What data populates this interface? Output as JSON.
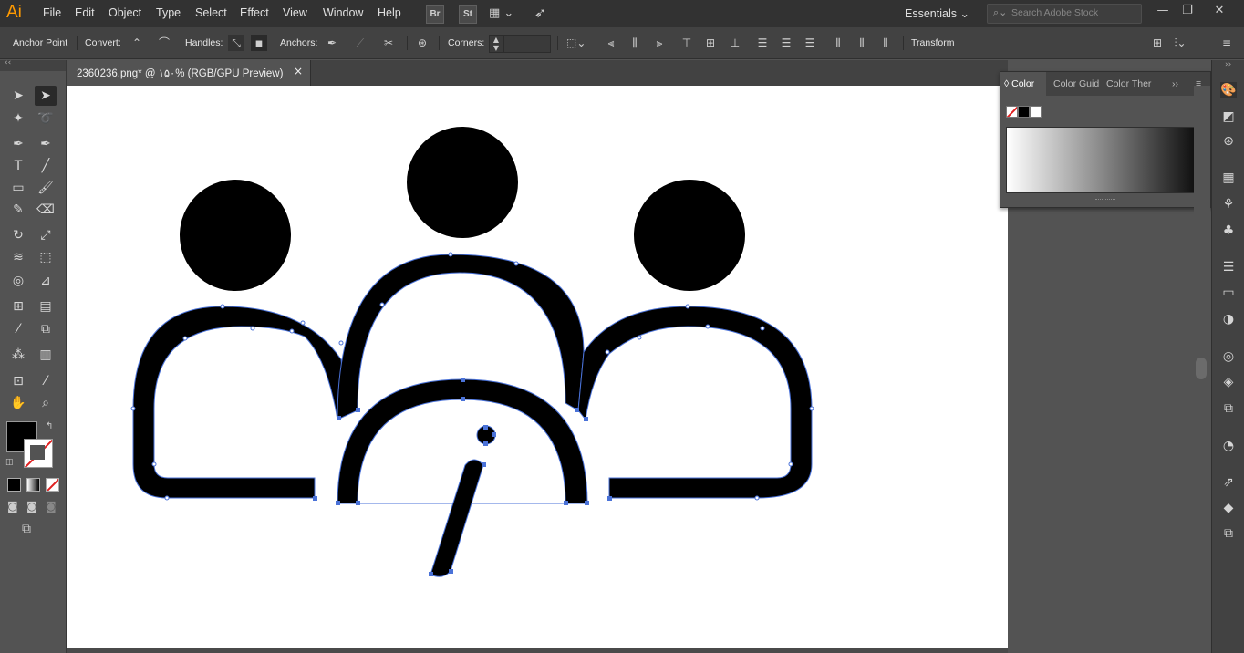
{
  "app": {
    "logo": "Ai"
  },
  "menu": [
    "File",
    "Edit",
    "Object",
    "Type",
    "Select",
    "Effect",
    "View",
    "Window",
    "Help"
  ],
  "menubar_icons": {
    "bridge": "Br",
    "stock": "St"
  },
  "workspace": {
    "label": "Essentials"
  },
  "search": {
    "placeholder": "Search Adobe Stock"
  },
  "control_bar": {
    "anchor_point": "Anchor Point",
    "convert": "Convert:",
    "handles": "Handles:",
    "anchors": "Anchors:",
    "corners": "Corners:",
    "transform": "Transform"
  },
  "document_tab": {
    "title": "2360236.png* @ ۱۵۰% (RGB/GPU Preview)",
    "close": "×"
  },
  "color_panel": {
    "tabs": [
      "Color",
      "Color Guid",
      "Color Ther"
    ],
    "spectrum_colors": [
      "#ffffff",
      "#111111"
    ]
  },
  "colors": {
    "fill": "#000000",
    "stroke": "none",
    "selection": "#4a72d8",
    "accent": "#ff9a00"
  },
  "icons": {
    "toolbox": [
      "selection-icon",
      "direct-selection-icon",
      "magic-wand-icon",
      "lasso-icon",
      "pen-icon",
      "curvature-icon",
      "type-icon",
      "line-icon",
      "rectangle-icon",
      "paintbrush-icon",
      "shaper-icon",
      "eraser-icon",
      "rotate-icon",
      "scale-icon",
      "warp-icon",
      "free-transform-icon",
      "shape-builder-icon",
      "perspective-icon",
      "mesh-icon",
      "gradient-icon",
      "eyedropper-icon",
      "blend-icon",
      "symbol-sprayer-icon",
      "column-graph-icon",
      "artboard-icon",
      "slice-icon",
      "hand-icon",
      "zoom-icon"
    ],
    "dock": [
      "color-icon",
      "color-guide-icon",
      "color-themes-icon",
      "swatches-icon",
      "brushes-icon",
      "symbols-icon",
      "stroke-icon",
      "gradient-icon",
      "transparency-icon",
      "appearance-icon",
      "graphic-styles-icon",
      "layers-export-icon",
      "asset-export-icon",
      "layers-icon",
      "artboards-icon"
    ]
  }
}
